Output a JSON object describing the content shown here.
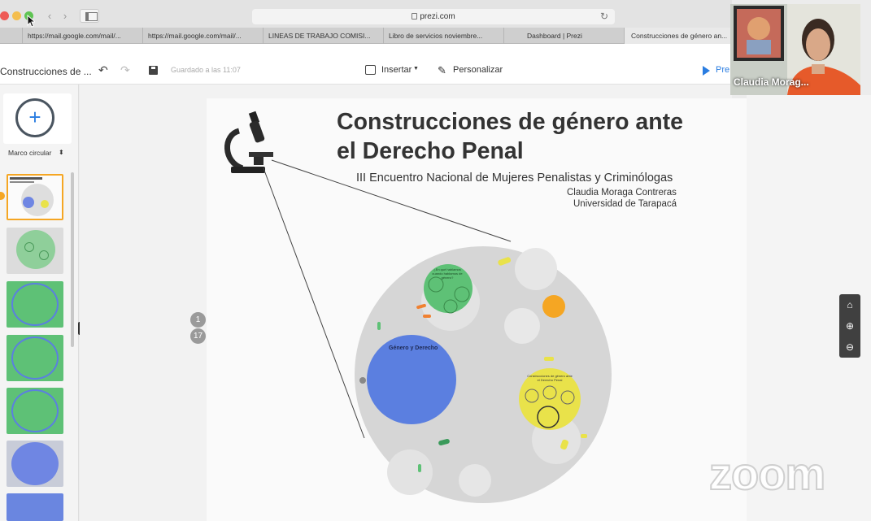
{
  "browser": {
    "url": "prezi.com",
    "tabs": [
      {
        "label": "https://mail.google.com/mail/..."
      },
      {
        "label": "https://mail.google.com/mail/..."
      },
      {
        "label": "LINEAS DE TRABAJO COMISI..."
      },
      {
        "label": "Libro de servicios noviembre..."
      },
      {
        "label": "Dashboard | Prezi"
      },
      {
        "label": "Construcciones de género an..."
      }
    ]
  },
  "toolbar": {
    "presentation_title": "Construcciones de ...",
    "saved_status": "Guardado a las 11:07",
    "insert_label": "Insertar",
    "customize_label": "Personalizar",
    "present_label": "Pre"
  },
  "left_panel": {
    "frame_type": "Marco circular",
    "thumb_colors": [
      "#f0f0f0",
      "#8fcf9a",
      "#5ec176",
      "#5ec176",
      "#5ec176",
      "#8a9fe0",
      "#6a86e0"
    ]
  },
  "slide": {
    "title_line1": "Construcciones de género ante",
    "title_line2": "el Derecho Penal",
    "subtitle": "III Encuentro Nacional de Mujeres Penalistas y Criminólogas",
    "author": "Claudia Moraga Contreras",
    "university": "Universidad de Tarapacá",
    "bubble_blue": "Género y Derecho",
    "bubble_green": "¿En qué hablamos cuando hablamos de género?",
    "bubble_yellow": "Construcciones de género ante el Derecho Penal"
  },
  "navigation": {
    "current_page": "1",
    "total_pages": "17"
  },
  "participant": {
    "name": "Claudia Morag..."
  },
  "watermark": "zoom",
  "colors": {
    "accent": "#2a7de1",
    "green": "#5ec176",
    "blue": "#5b7fe0",
    "yellow": "#e9e24a",
    "orange": "#f5a623"
  }
}
